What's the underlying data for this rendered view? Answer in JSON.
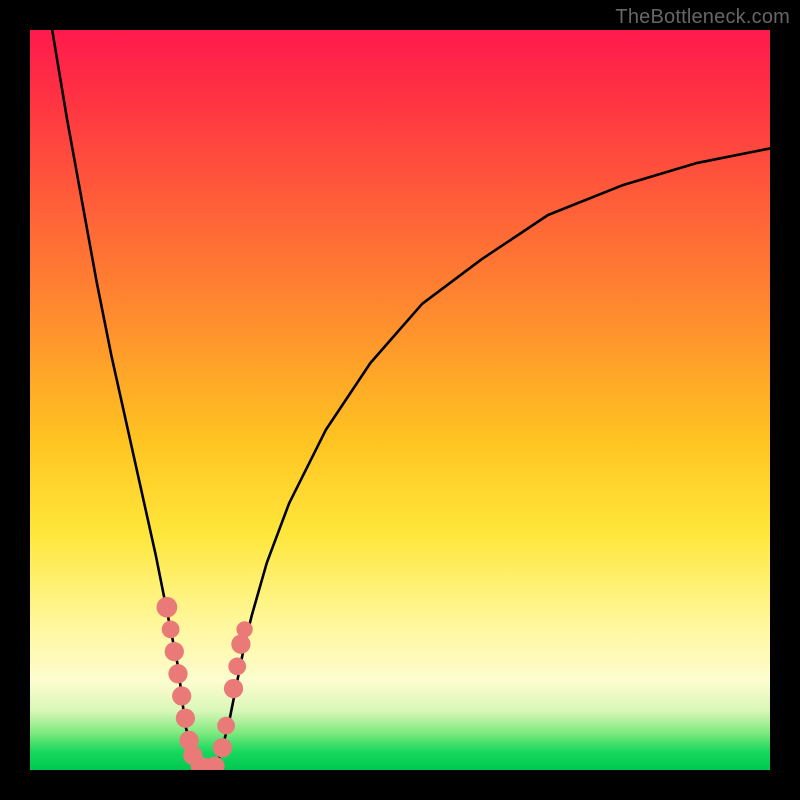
{
  "watermark": "TheBottleneck.com",
  "colors": {
    "frame": "#000000",
    "curve": "#000000",
    "marker": "#e97a78",
    "gradient_top": "#ff1a4d",
    "gradient_bottom": "#00c851"
  },
  "chart_data": {
    "type": "line",
    "title": "",
    "xlabel": "",
    "ylabel": "",
    "xlim": [
      0,
      100
    ],
    "ylim": [
      0,
      100
    ],
    "grid": false,
    "legend": false,
    "note": "Axes are unlabeled in the image. x/y values below are estimated percentages of the plot area (0 = left/bottom, 100 = right/top).",
    "series": [
      {
        "name": "left-branch",
        "x": [
          3,
          5,
          7,
          9,
          11,
          13,
          15,
          17,
          18,
          19,
          20,
          20.5,
          21,
          22,
          23
        ],
        "y": [
          100,
          88,
          77,
          66,
          56,
          47,
          38,
          29,
          24,
          19,
          14,
          10,
          6,
          2,
          0
        ]
      },
      {
        "name": "right-branch",
        "x": [
          25,
          26,
          27,
          28,
          29,
          30,
          32,
          35,
          40,
          46,
          53,
          61,
          70,
          80,
          90,
          100
        ],
        "y": [
          0,
          3,
          7,
          12,
          17,
          21,
          28,
          36,
          46,
          55,
          63,
          69,
          75,
          79,
          82,
          84
        ]
      }
    ],
    "markers": {
      "name": "highlighted-points",
      "color": "#e97a78",
      "points": [
        {
          "x": 18.5,
          "y": 22,
          "r": 1.4
        },
        {
          "x": 19.0,
          "y": 19,
          "r": 1.2
        },
        {
          "x": 19.5,
          "y": 16,
          "r": 1.3
        },
        {
          "x": 20.0,
          "y": 13,
          "r": 1.3
        },
        {
          "x": 20.5,
          "y": 10,
          "r": 1.3
        },
        {
          "x": 21.0,
          "y": 7,
          "r": 1.3
        },
        {
          "x": 21.5,
          "y": 4,
          "r": 1.3
        },
        {
          "x": 22.0,
          "y": 2,
          "r": 1.3
        },
        {
          "x": 23.0,
          "y": 0.5,
          "r": 1.3
        },
        {
          "x": 24.0,
          "y": 0.3,
          "r": 1.3
        },
        {
          "x": 25.0,
          "y": 0.5,
          "r": 1.3
        },
        {
          "x": 26.0,
          "y": 3,
          "r": 1.3
        },
        {
          "x": 26.5,
          "y": 6,
          "r": 1.2
        },
        {
          "x": 27.5,
          "y": 11,
          "r": 1.3
        },
        {
          "x": 28.0,
          "y": 14,
          "r": 1.2
        },
        {
          "x": 28.5,
          "y": 17,
          "r": 1.3
        },
        {
          "x": 29.0,
          "y": 19,
          "r": 1.1
        }
      ]
    }
  }
}
